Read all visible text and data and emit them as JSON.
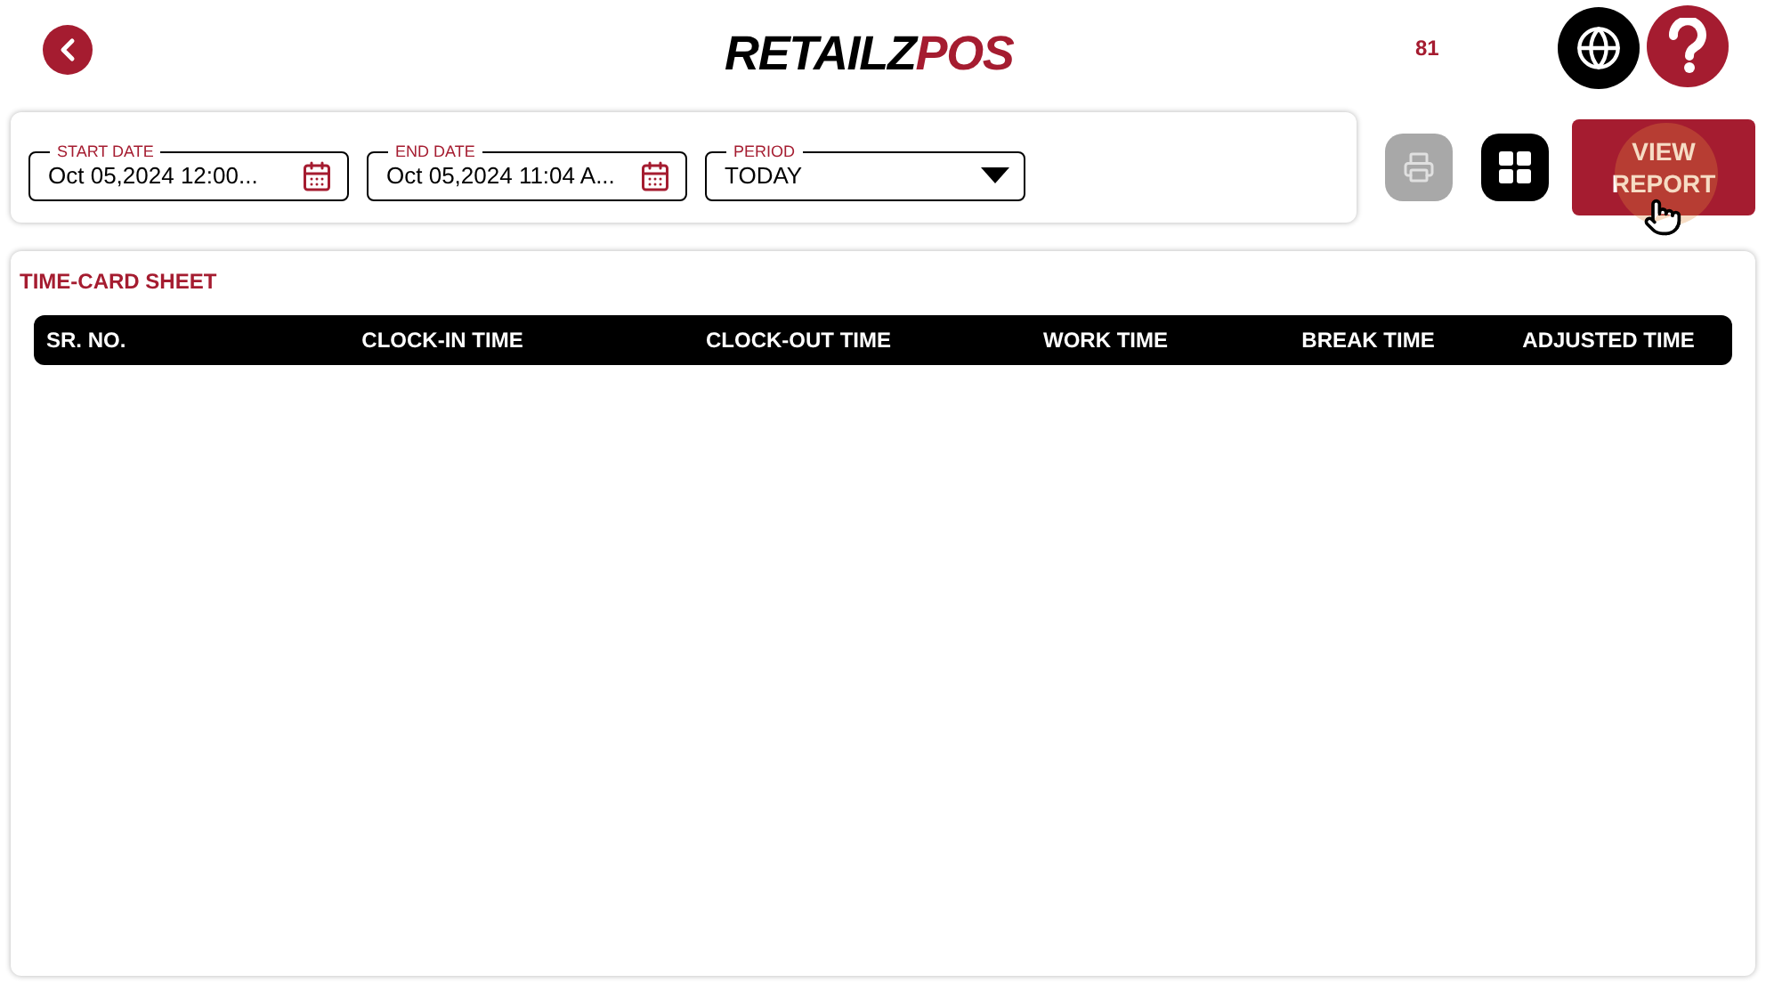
{
  "header": {
    "logo": {
      "primary": "RETAILZ",
      "accent": "POS"
    },
    "counter": "81"
  },
  "filters": [
    {
      "kind": "date",
      "label": "START DATE",
      "value": "Oct 05,2024 12:00..."
    },
    {
      "kind": "date",
      "label": "END DATE",
      "value": "Oct 05,2024 11:04 A..."
    },
    {
      "kind": "select",
      "label": "PERIOD",
      "value": "TODAY"
    }
  ],
  "toolbar": {
    "print_disabled": true,
    "view_report": "VIEW REPORT"
  },
  "report": {
    "title": "TIME-CARD SHEET",
    "columns": [
      "SR. NO.",
      "CLOCK-IN TIME",
      "CLOCK-OUT TIME",
      "WORK TIME",
      "BREAK TIME",
      "ADJUSTED TIME"
    ]
  }
}
